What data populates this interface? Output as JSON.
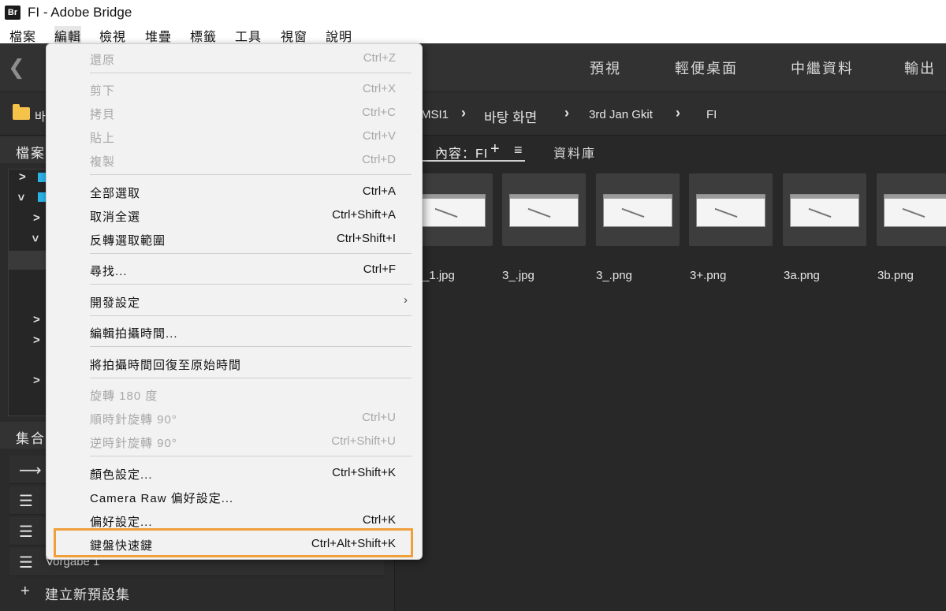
{
  "window": {
    "logo": "Br",
    "title": "FI - Adobe Bridge"
  },
  "menubar": [
    "檔案",
    "編輯",
    "檢視",
    "堆疊",
    "標籤",
    "工具",
    "視窗",
    "說明"
  ],
  "workspace_tabs": [
    "預視",
    "輕便桌面",
    "中繼資料",
    "輸出"
  ],
  "path": {
    "first": "바",
    "items": [
      "MSI1",
      "바탕 화면",
      "3rd Jan Gkit",
      "FI"
    ]
  },
  "panels": {
    "files": "檔案",
    "collections": "集合"
  },
  "collections": {
    "vorgabe": "Vorgabe 1",
    "new_preset": "建立新預設集"
  },
  "content": {
    "tab_label": "內容：FI",
    "library_tab": "資料庫"
  },
  "thumbnails": [
    "_1.jpg",
    "3_.jpg",
    "3_.png",
    "3+.png",
    "3a.png",
    "3b.png"
  ],
  "edit_menu": {
    "undo": {
      "label": "還原",
      "shortcut": "Ctrl+Z"
    },
    "cut": {
      "label": "剪下",
      "shortcut": "Ctrl+X"
    },
    "copy": {
      "label": "拷貝",
      "shortcut": "Ctrl+C"
    },
    "paste": {
      "label": "貼上",
      "shortcut": "Ctrl+V"
    },
    "duplicate": {
      "label": "複製",
      "shortcut": "Ctrl+D"
    },
    "select_all": {
      "label": "全部選取",
      "shortcut": "Ctrl+A"
    },
    "deselect_all": {
      "label": "取消全選",
      "shortcut": "Ctrl+Shift+A"
    },
    "invert_selection": {
      "label": "反轉選取範圍",
      "shortcut": "Ctrl+Shift+I"
    },
    "find": {
      "label": "尋找...",
      "shortcut": "Ctrl+F"
    },
    "develop_settings": {
      "label": "開發設定"
    },
    "edit_capture_time": {
      "label": "編輯拍攝時間..."
    },
    "revert_capture_time": {
      "label": "將拍攝時間回復至原始時間"
    },
    "rotate_180": {
      "label": "旋轉 180 度"
    },
    "rotate_cw": {
      "label": "順時針旋轉 90°",
      "shortcut": "Ctrl+U"
    },
    "rotate_ccw": {
      "label": "逆時針旋轉 90°",
      "shortcut": "Ctrl+Shift+U"
    },
    "color_settings": {
      "label": "顏色設定...",
      "shortcut": "Ctrl+Shift+K"
    },
    "camera_raw_prefs": {
      "label": "Camera Raw 偏好設定..."
    },
    "preferences": {
      "label": "偏好設定...",
      "shortcut": "Ctrl+K"
    },
    "keyboard_shortcuts": {
      "label": "鍵盤快速鍵",
      "shortcut": "Ctrl+Alt+Shift+K"
    }
  }
}
